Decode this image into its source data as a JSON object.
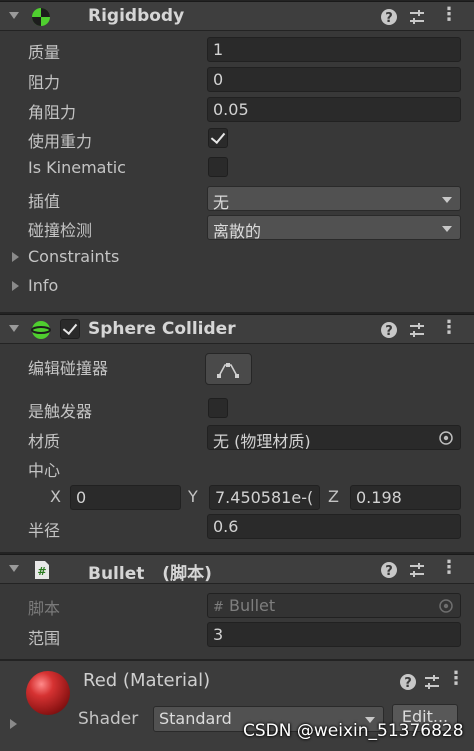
{
  "rigidbody": {
    "title": "Rigidbody",
    "icon": "rigidbody-icon",
    "fields": {
      "mass_label": "质量",
      "mass_value": "1",
      "drag_label": "阻力",
      "drag_value": "0",
      "angular_drag_label": "角阻力",
      "angular_drag_value": "0.05",
      "use_gravity_label": "使用重力",
      "use_gravity_checked": true,
      "is_kinematic_label": "Is Kinematic",
      "is_kinematic_checked": false,
      "interpolate_label": "插值",
      "interpolate_value": "无",
      "collision_detection_label": "碰撞检测",
      "collision_detection_value": "离散的"
    },
    "constraints_label": "Constraints",
    "info_label": "Info"
  },
  "sphere_collider": {
    "title": "Sphere Collider",
    "enabled": true,
    "edit_collider_label": "编辑碰撞器",
    "is_trigger_label": "是触发器",
    "is_trigger_checked": false,
    "material_label": "材质",
    "material_value": "无 (物理材质)",
    "center_label": "中心",
    "center_x_label": "X",
    "center_x": "0",
    "center_y_label": "Y",
    "center_y": "7.450581e-(",
    "center_z_label": "Z",
    "center_z": "0.198",
    "radius_label": "半径",
    "radius_value": "0.6"
  },
  "bullet_script": {
    "title": "Bullet",
    "title_suffix": "(脚本)",
    "script_label": "脚本",
    "script_value": "Bullet",
    "range_label": "范围",
    "range_value": "3"
  },
  "material": {
    "title": "Red (Material)",
    "shader_label": "Shader",
    "shader_value": "Standard",
    "edit_label": "Edit...",
    "sphere_color": "#b51f1f"
  },
  "watermark": "CSDN @weixin_51376828",
  "colors": {
    "background": "#383838",
    "header": "#3e3e3e",
    "field": "#2a2a2a",
    "accent_green": "#4fcf2f"
  }
}
